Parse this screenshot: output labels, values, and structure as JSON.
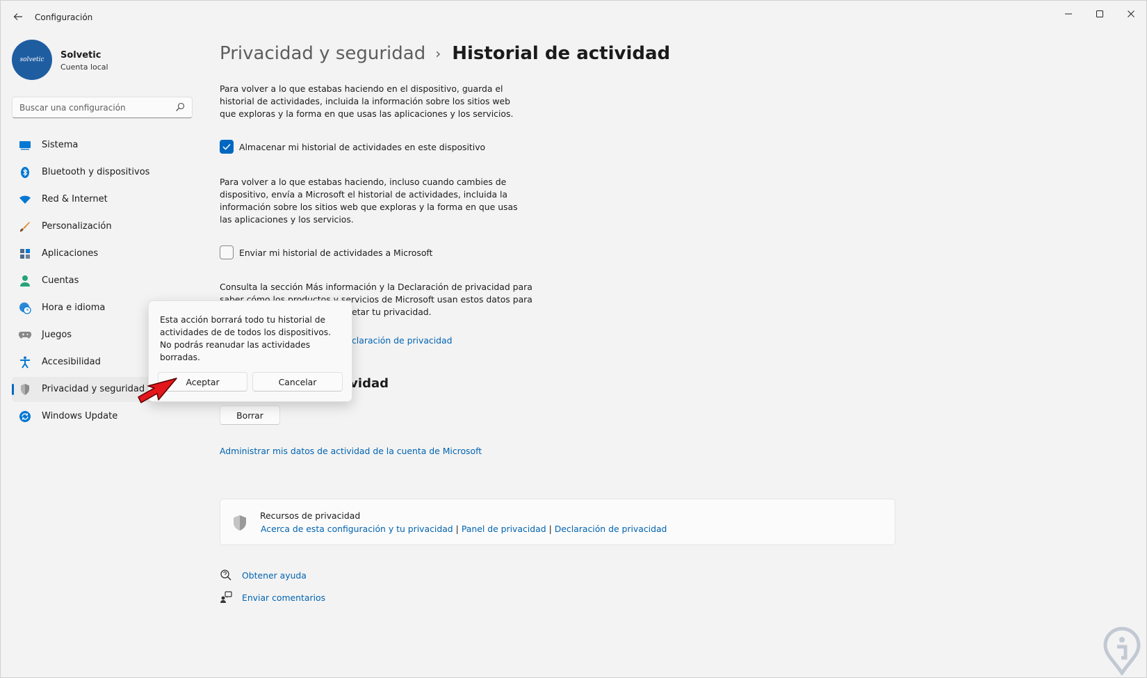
{
  "window": {
    "app_title": "Configuración",
    "back_icon": "arrow-left-icon",
    "controls": [
      "minimize-icon",
      "maximize-icon",
      "close-icon"
    ]
  },
  "profile": {
    "avatar_text": "solvetic",
    "name": "Solvetic",
    "account_type": "Cuenta local"
  },
  "search": {
    "placeholder": "Buscar una configuración"
  },
  "sidebar": {
    "items": [
      {
        "label": "Sistema",
        "icon": "monitor-icon",
        "color": "#0078d4"
      },
      {
        "label": "Bluetooth y dispositivos",
        "icon": "bluetooth-icon",
        "color": "#0078d4"
      },
      {
        "label": "Red & Internet",
        "icon": "wifi-icon",
        "color": "#0078d4"
      },
      {
        "label": "Personalización",
        "icon": "brush-icon",
        "color": "#e08a2e"
      },
      {
        "label": "Aplicaciones",
        "icon": "apps-icon",
        "color": "#4a6a8a"
      },
      {
        "label": "Cuentas",
        "icon": "person-icon",
        "color": "#26a37a"
      },
      {
        "label": "Hora e idioma",
        "icon": "globe-clock-icon",
        "color": "#0078d4"
      },
      {
        "label": "Juegos",
        "icon": "gamepad-icon",
        "color": "#7a7a7a"
      },
      {
        "label": "Accesibilidad",
        "icon": "accessibility-icon",
        "color": "#0078d4"
      },
      {
        "label": "Privacidad y seguridad",
        "icon": "shield-icon",
        "color": "#7a7a7a",
        "active": true
      },
      {
        "label": "Windows Update",
        "icon": "update-icon",
        "color": "#0078d4"
      }
    ]
  },
  "main": {
    "breadcrumb_parent": "Privacidad y seguridad",
    "breadcrumb_current": "Historial de actividad",
    "para1": "Para volver a lo que estabas haciendo en el dispositivo, guarda el historial de actividades, incluida la información sobre los sitios web que exploras y la forma en que usas las aplicaciones y los servicios.",
    "check_store_label": "Almacenar mi historial de actividades en este dispositivo",
    "check_store_checked": true,
    "para2": "Para volver a lo que estabas haciendo, incluso cuando cambies de dispositivo, envía a Microsoft el historial de actividades, incluida la información sobre los sitios web que exploras y la forma en que usas las aplicaciones y los servicios.",
    "check_send_label": "Enviar mi historial de actividades a Microsoft",
    "check_send_checked": false,
    "para3_line1": "Consulta la sección Más información y la Declaración de privacidad para",
    "para3_line2": "saber cómo los productos y servicios de Microsoft usan estos datos para",
    "para3_line3": "etar tu privacidad.",
    "privacy_link_fragment": "claración de privacidad",
    "section_title_fragment": "ividad",
    "clear_button": "Borrar",
    "manage_link": "Administrar mis datos de actividad de la cuenta de Microsoft"
  },
  "resources_card": {
    "icon": "shield-icon",
    "title": "Recursos de privacidad",
    "links": [
      "Acerca de esta configuración y tu privacidad",
      "Panel de privacidad",
      "Declaración de privacidad"
    ],
    "separator": "|"
  },
  "help": {
    "get_help": "Obtener ayuda",
    "get_help_icon": "help-search-icon",
    "feedback": "Enviar comentarios",
    "feedback_icon": "feedback-icon"
  },
  "popup": {
    "message": "Esta acción borrará todo tu historial de actividades de  de todos los dispositivos. No podrás reanudar las actividades borradas.",
    "accept": "Aceptar",
    "cancel": "Cancelar"
  },
  "annotation": {
    "arrow_icon": "red-arrow-icon",
    "arrow_color": "#e3161b"
  },
  "colors": {
    "accent": "#0067c0",
    "link": "#0063b1",
    "background": "#f3f3f3"
  }
}
